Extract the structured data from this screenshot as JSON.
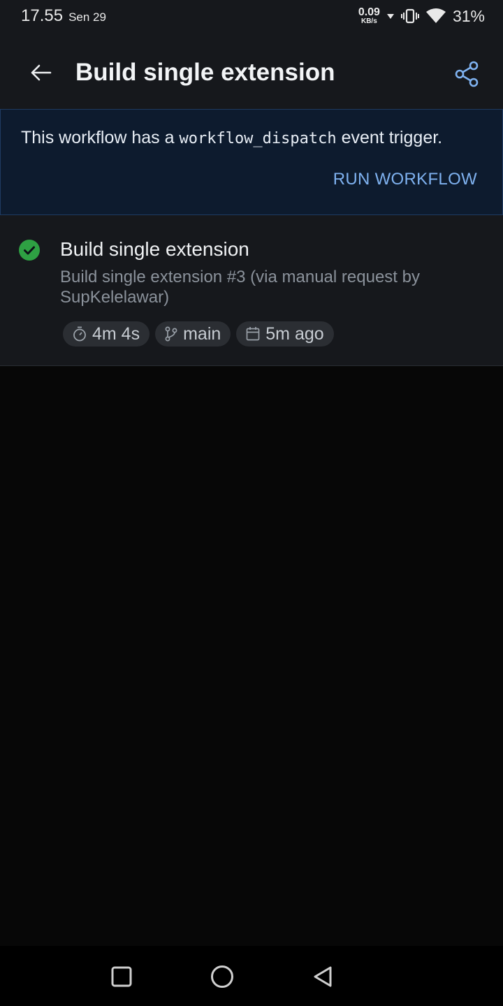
{
  "status_bar": {
    "time": "17.55",
    "date": "Sen 29",
    "net_speed_value": "0.09",
    "net_speed_unit": "KB/s",
    "battery": "31%"
  },
  "app_bar": {
    "title": "Build single extension",
    "icons": [
      "arrow-left-icon",
      "share-icon"
    ]
  },
  "banner": {
    "text_before": "This workflow has a ",
    "code": "workflow_dispatch",
    "text_after": " event trigger.",
    "action_label": "RUN WORKFLOW"
  },
  "run": {
    "status": "success",
    "title": "Build single extension",
    "description": "Build single extension #3 (via manual request by SupKelelawar)",
    "duration": "4m 4s",
    "branch": "main",
    "time_ago": "5m ago"
  },
  "colors": {
    "accent": "#7fb2f0",
    "success": "#2ea043",
    "banner_bg": "#0d1b2e",
    "surface": "#16181c"
  }
}
